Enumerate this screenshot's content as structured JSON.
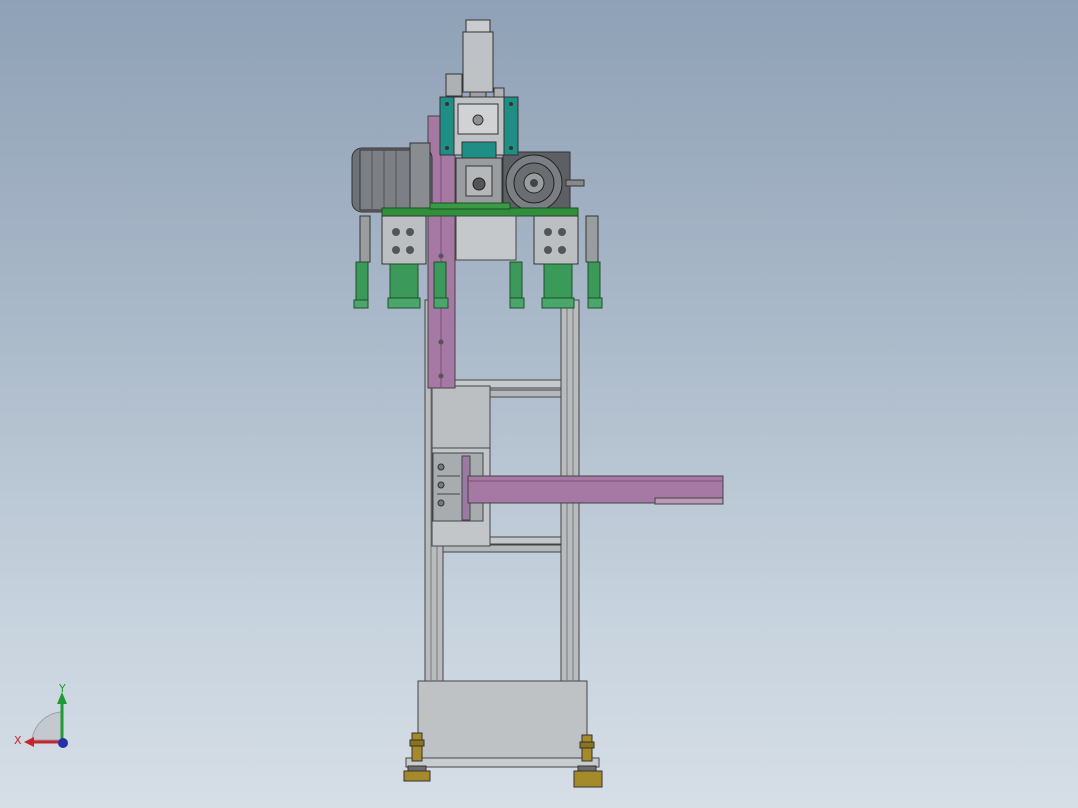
{
  "view": {
    "background_top": "#8fa1b6",
    "background_bottom": "#d6dee6"
  },
  "model": {
    "frame_color": "#b8bbbe",
    "motor_color": "#6e7175",
    "bracket_color": "#1f8f86",
    "beam_color": "#a678a4",
    "plate_color": "#2f8f3a",
    "gripper_color": "#3b9a5a",
    "foot_color": "#a58a2a"
  },
  "triad": {
    "x_label": "X",
    "y_label": "Y",
    "x_color": "#c8252b",
    "y_color": "#1f9a36",
    "z_color": "#2430a8"
  }
}
